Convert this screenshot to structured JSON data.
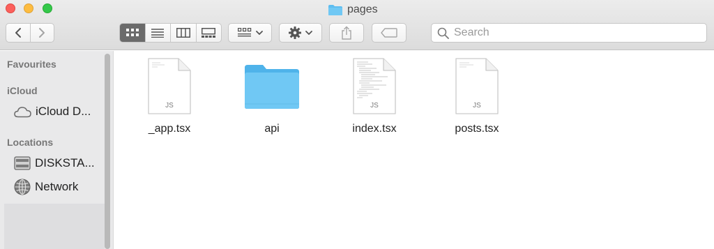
{
  "window": {
    "title": "pages"
  },
  "toolbar": {
    "nav": {
      "back": "back",
      "forward": "forward"
    },
    "search": {
      "placeholder": "Search",
      "value": ""
    }
  },
  "sidebar": {
    "sections": [
      {
        "heading": "Favourites",
        "items": []
      },
      {
        "heading": "iCloud",
        "items": [
          {
            "label": "iCloud D...",
            "icon": "cloud-icon"
          }
        ]
      },
      {
        "heading": "Locations",
        "items": [
          {
            "label": "DISKSTA...",
            "icon": "server-icon"
          },
          {
            "label": "Network",
            "icon": "network-globe-icon"
          }
        ]
      }
    ]
  },
  "files": [
    {
      "name": "_app.tsx",
      "kind": "file",
      "badge": "JS",
      "preview": false
    },
    {
      "name": "api",
      "kind": "folder"
    },
    {
      "name": "index.tsx",
      "kind": "file",
      "badge": "JS",
      "preview": true
    },
    {
      "name": "posts.tsx",
      "kind": "file",
      "badge": "JS",
      "preview": false
    }
  ],
  "colors": {
    "folder": "#5ebdf0",
    "close": "#fc605c",
    "minimize": "#fdbc40",
    "maximize": "#34c84a",
    "active_view": "#6b6b6b"
  }
}
